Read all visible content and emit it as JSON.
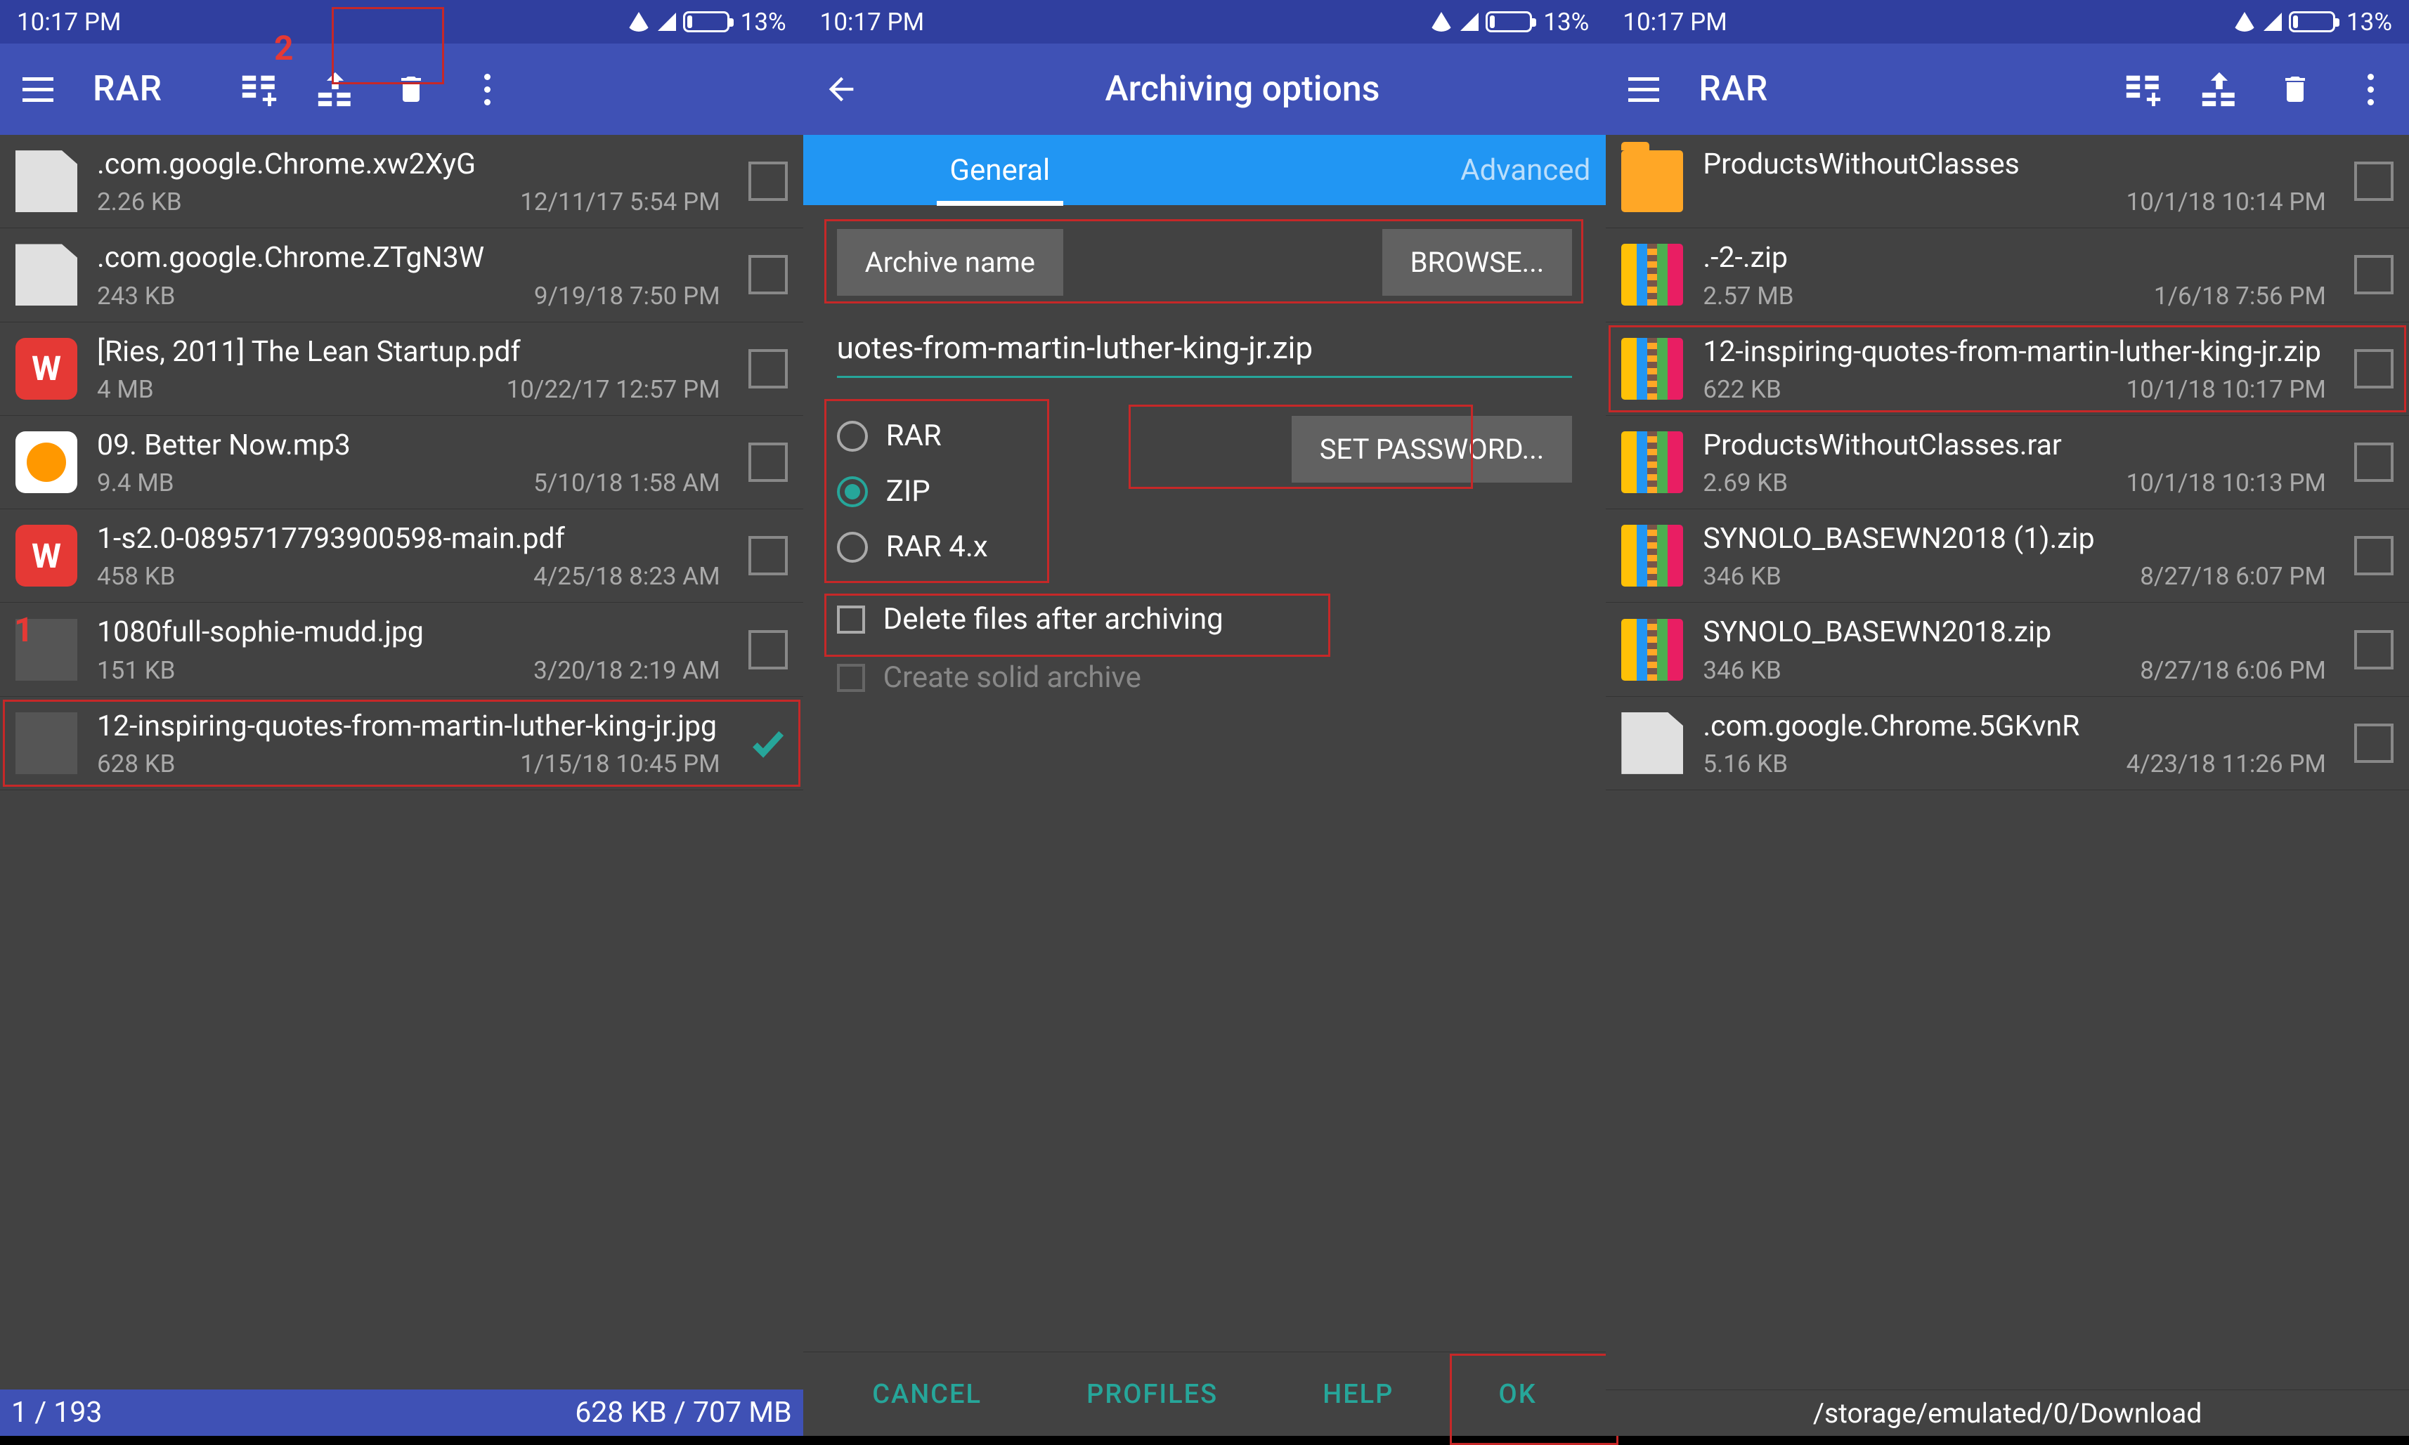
{
  "status": {
    "time": "10:17 PM",
    "battery": "13%"
  },
  "s1": {
    "app_title": "RAR",
    "annotation_2": "2",
    "annotation_1": "1",
    "files": [
      {
        "name": ".com.google.Chrome.xw2XyG",
        "size": "2.26 KB",
        "date": "12/11/17 5:54 PM",
        "icon": "doc",
        "checked": false
      },
      {
        "name": ".com.google.Chrome.ZTgN3W",
        "size": "243 KB",
        "date": "9/19/18 7:50 PM",
        "icon": "doc",
        "checked": false
      },
      {
        "name": "[Ries, 2011] The Lean Startup.pdf",
        "size": "4 MB",
        "date": "10/22/17 12:57 PM",
        "icon": "wps",
        "checked": false
      },
      {
        "name": "09. Better Now.mp3",
        "size": "9.4 MB",
        "date": "5/10/18 1:58 AM",
        "icon": "music",
        "checked": false
      },
      {
        "name": "1-s2.0-0895717793900598-main.pdf",
        "size": "458 KB",
        "date": "4/25/18 8:23 AM",
        "icon": "wps",
        "checked": false
      },
      {
        "name": "1080full-sophie-mudd.jpg",
        "size": "151 KB",
        "date": "3/20/18 2:19 AM",
        "icon": "img",
        "checked": false
      },
      {
        "name": "12-inspiring-quotes-from-martin-luther-king-jr.jpg",
        "size": "628 KB",
        "date": "1/15/18 10:45 PM",
        "icon": "img",
        "checked": true
      }
    ],
    "footer_left": "1 / 193",
    "footer_right": "628 KB / 707 MB"
  },
  "s2": {
    "title": "Archiving options",
    "tabs": {
      "general": "General",
      "advanced": "Advanced"
    },
    "archive_name_btn": "Archive name",
    "browse_btn": "BROWSE...",
    "filename_value": "uotes-from-martin-luther-king-jr.zip",
    "formats": {
      "rar": "RAR",
      "zip": "ZIP",
      "rar4": "RAR 4.x"
    },
    "set_password_btn": "SET PASSWORD...",
    "delete_after": "Delete files after archiving",
    "solid_archive": "Create solid archive",
    "actions": {
      "cancel": "CANCEL",
      "profiles": "PROFILES",
      "help": "HELP",
      "ok": "OK"
    }
  },
  "s3": {
    "app_title": "RAR",
    "files": [
      {
        "name": "ProductsWithoutClasses",
        "size": "",
        "date": "10/1/18 10:14 PM",
        "icon": "folder"
      },
      {
        "name": ".-2-.zip",
        "size": "2.57 MB",
        "date": "1/6/18 7:56 PM",
        "icon": "rar"
      },
      {
        "name": "12-inspiring-quotes-from-martin-luther-king-jr.zip",
        "size": "622 KB",
        "date": "10/1/18 10:17 PM",
        "icon": "rar"
      },
      {
        "name": "ProductsWithoutClasses.rar",
        "size": "2.69 KB",
        "date": "10/1/18 10:13 PM",
        "icon": "rar"
      },
      {
        "name": "SYNOLO_BASEWN2018 (1).zip",
        "size": "346 KB",
        "date": "8/27/18 6:07 PM",
        "icon": "rar"
      },
      {
        "name": "SYNOLO_BASEWN2018.zip",
        "size": "346 KB",
        "date": "8/27/18 6:06 PM",
        "icon": "rar"
      },
      {
        "name": ".com.google.Chrome.5GKvnR",
        "size": "5.16 KB",
        "date": "4/23/18 11:26 PM",
        "icon": "doc"
      }
    ],
    "path": "/storage/emulated/0/Download"
  }
}
